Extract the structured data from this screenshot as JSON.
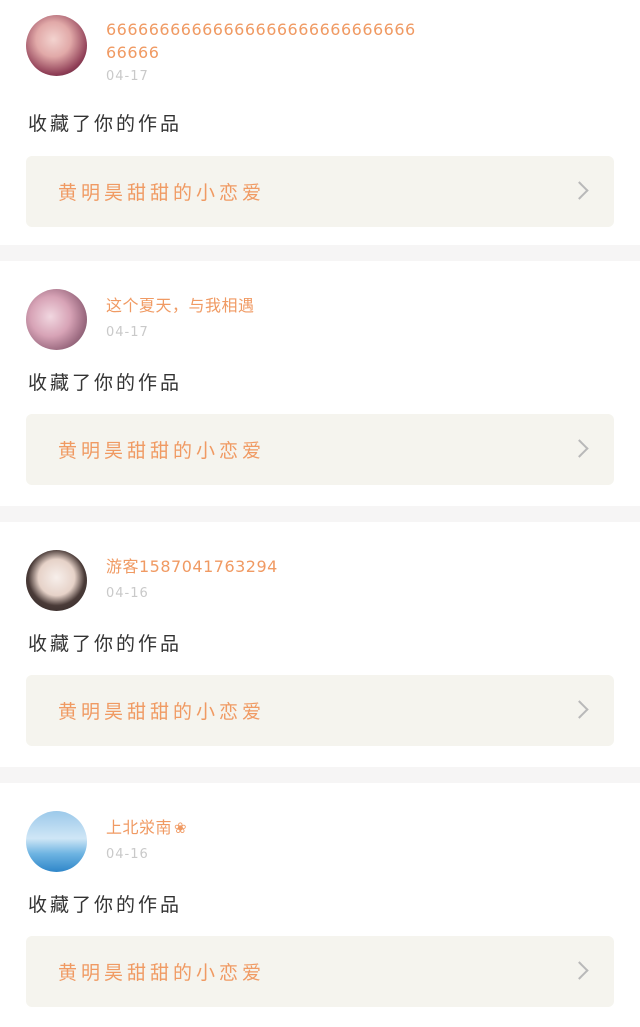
{
  "notifications": [
    {
      "avatar": "user-avatar-photo",
      "username": "6666666666666666666666666666666666",
      "date": "04-17",
      "action": "收藏了你的作品",
      "work_title": "黄明昊甜甜的小恋爱"
    },
    {
      "avatar": "cherry-blossom-avatar",
      "username": "这个夏天，与我相遇",
      "date": "04-17",
      "action": "收藏了你的作品",
      "work_title": "黄明昊甜甜的小恋爱"
    },
    {
      "avatar": "user-avatar-photo",
      "username": "游客1587041763294",
      "date": "04-16",
      "action": "收藏了你的作品",
      "work_title": "黄明昊甜甜的小恋爱"
    },
    {
      "avatar": "sky-sea-avatar",
      "username": "上北泶南",
      "username_icon": "flower-icon",
      "date": "04-16",
      "action": "收藏了你的作品",
      "work_title": "黄明昊甜甜的小恋爱"
    }
  ],
  "colors": {
    "accent": "#f09a63",
    "date": "#c9c9c9",
    "work_card_bg": "#f5f4ee",
    "separator": "#f6f5f5"
  }
}
